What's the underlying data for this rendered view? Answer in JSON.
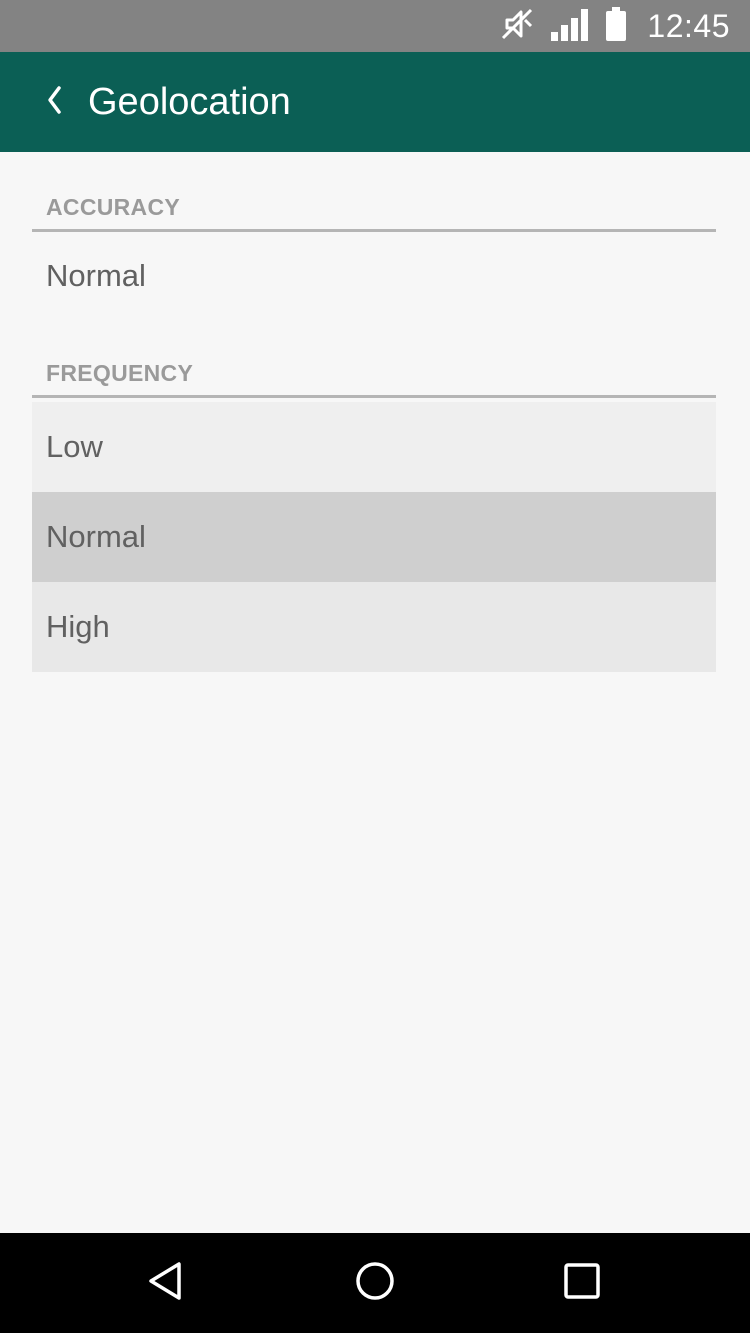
{
  "status_bar": {
    "time": "12:45",
    "icons": [
      "mute-icon",
      "signal-icon",
      "battery-icon"
    ]
  },
  "app_bar": {
    "back_icon": "chevron-left-icon",
    "title": "Geolocation"
  },
  "accuracy": {
    "header": "ACCURACY",
    "value": "Normal"
  },
  "frequency": {
    "header": "FREQUENCY",
    "options": [
      {
        "label": "Low"
      },
      {
        "label": "Normal",
        "selected": true
      },
      {
        "label": "High"
      }
    ]
  },
  "nav_bar": {
    "icons": [
      "back-triangle-icon",
      "home-circle-icon",
      "recents-square-icon"
    ]
  },
  "colors": {
    "status_bar": "#838383",
    "app_bar": "#0b5f55",
    "background": "#f7f7f7",
    "selected_item": "#cfcfcf"
  }
}
